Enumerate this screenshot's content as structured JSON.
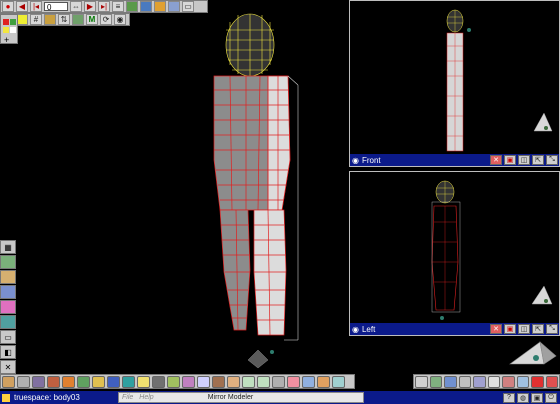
{
  "top_toolbar": {
    "frame_value": "0",
    "icons": [
      "record-icon",
      "rewind-icon",
      "prev-frame-icon",
      "play-icon",
      "next-frame-icon",
      "end-icon",
      "keyframe-icon",
      "scene-editor-icon",
      "render-icon",
      "object-tool-icon",
      "paint-icon",
      "sdk-icon"
    ]
  },
  "viewports": {
    "front": {
      "label": "Front"
    },
    "left": {
      "label": "Left"
    }
  },
  "status_bar": {
    "title": "truespace: body03",
    "panel_file": "File",
    "panel_help": "Help",
    "panel_title": "Mirror Modeler"
  },
  "colors": {
    "background": "#000000",
    "toolbar": "#c8c8c8",
    "title_bar": "#0b1a8a",
    "wire_red": "#e02020",
    "wire_yellow": "#f2e640",
    "body_gray": "#8c8c8c"
  }
}
